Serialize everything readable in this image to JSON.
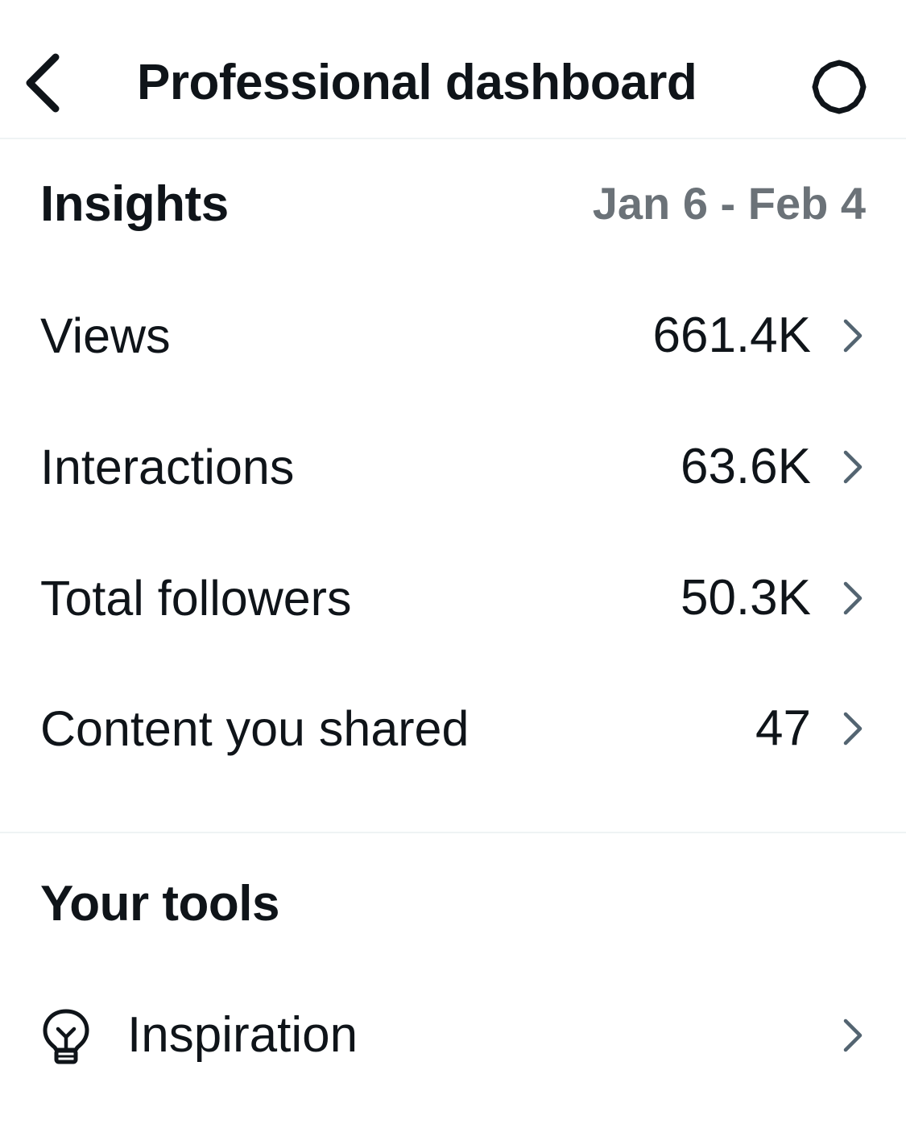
{
  "header": {
    "title": "Professional dashboard",
    "back_icon": "chevron-left-icon",
    "settings_icon": "gear-icon"
  },
  "insights": {
    "title": "Insights",
    "date_range": "Jan 6 - Feb 4",
    "metrics": [
      {
        "label": "Views",
        "value": "661.4K"
      },
      {
        "label": "Interactions",
        "value": "63.6K"
      },
      {
        "label": "Total followers",
        "value": "50.3K"
      },
      {
        "label": "Content you shared",
        "value": "47"
      }
    ]
  },
  "tools": {
    "title": "Your tools",
    "items": [
      {
        "label": "Inspiration",
        "icon": "lightbulb-icon"
      }
    ]
  },
  "colors": {
    "text": "#0f1419",
    "muted": "#6b7278",
    "divider": "#eff3f4",
    "chevron": "#536471"
  }
}
